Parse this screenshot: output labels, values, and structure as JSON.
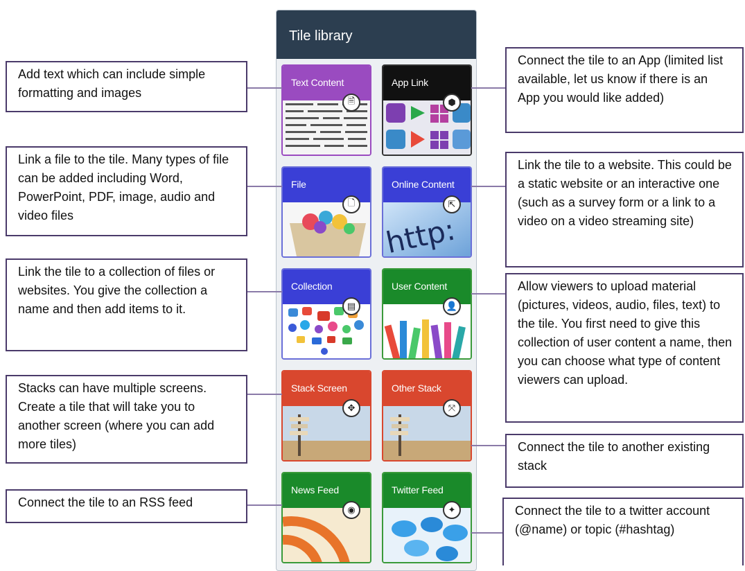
{
  "panel": {
    "title": "Tile library"
  },
  "tiles": [
    {
      "label": "Text Content",
      "badge": "🗎",
      "band": "#9a4bc0",
      "border": "#9a4bc0"
    },
    {
      "label": "App Link",
      "badge": "⬢",
      "band": "#111111",
      "border": "#333333"
    },
    {
      "label": "File",
      "badge": "🗋",
      "band": "#3a3fd6",
      "border": "#6a6fd8"
    },
    {
      "label": "Online Content",
      "badge": "⇱",
      "band": "#3a3fd6",
      "border": "#6a6fd8"
    },
    {
      "label": "Collection",
      "badge": "▤",
      "band": "#3a3fd6",
      "border": "#6a6fd8"
    },
    {
      "label": "User Content",
      "badge": "👤",
      "band": "#1a8a2a",
      "border": "#3a9a3a"
    },
    {
      "label": "Stack Screen",
      "badge": "✥",
      "band": "#d9472e",
      "border": "#d9472e"
    },
    {
      "label": "Other Stack",
      "badge": "⤧",
      "band": "#d9472e",
      "border": "#d9472e"
    },
    {
      "label": "News Feed",
      "badge": "◉",
      "band": "#1a8a2a",
      "border": "#3a9a3a"
    },
    {
      "label": "Twitter Feed",
      "badge": "✦",
      "band": "#1a8a2a",
      "border": "#3a9a3a"
    }
  ],
  "callouts": [
    {
      "text": "Add text which can include simple formatting and images"
    },
    {
      "text": "Link a file to the tile. Many types of file can be added including Word, PowerPoint, PDF, image, audio and video files"
    },
    {
      "text": "Link the tile to a collection of files or websites. You give the collection a name and then add items to it."
    },
    {
      "text": "Stacks can have multiple screens. Create a tile that will take you to another screen (where you can add more tiles)"
    },
    {
      "text": "Connect the tile to an RSS feed"
    },
    {
      "text": "Connect the tile to an App (limited list available, let us know if there is an App you would like added)"
    },
    {
      "text": "Link the tile to a website. This could be a static website or an interactive one (such as a survey form or a link to a video on a video streaming site)"
    },
    {
      "text": "Allow viewers to upload material (pictures, videos, audio, files, text) to the tile. You first need to give this collection of user content a name, then you can choose what type of content viewers can upload."
    },
    {
      "text": "Connect the tile to another existing stack"
    },
    {
      "text": "Connect the tile to a twitter account (@name) or topic (#hashtag)"
    }
  ],
  "thumbs": {
    "online_text": "http:"
  }
}
